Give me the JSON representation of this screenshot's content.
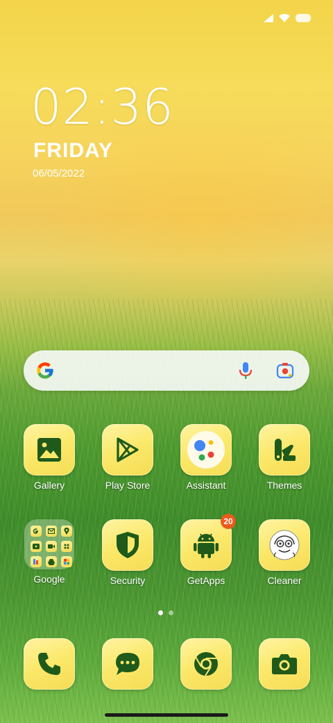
{
  "clock": {
    "time": "02:36",
    "day": "FRIDAY",
    "date": "06/05/2022"
  },
  "search": {
    "provider_icon": "google-g-icon",
    "voice_icon": "mic-icon",
    "lens_icon": "lens-camera-icon"
  },
  "apps_row1": [
    {
      "label": "Gallery",
      "icon": "gallery-icon"
    },
    {
      "label": "Play Store",
      "icon": "play-store-icon"
    },
    {
      "label": "Assistant",
      "icon": "assistant-icon"
    },
    {
      "label": "Themes",
      "icon": "themes-icon"
    }
  ],
  "apps_row2": [
    {
      "label": "Google",
      "icon": "folder-icon"
    },
    {
      "label": "Security",
      "icon": "shield-icon"
    },
    {
      "label": "GetApps",
      "icon": "android-icon",
      "badge": "20"
    },
    {
      "label": "Cleaner",
      "icon": "cleaner-icon"
    }
  ],
  "dock": [
    {
      "icon": "phone-icon"
    },
    {
      "icon": "messages-icon"
    },
    {
      "icon": "chrome-icon"
    },
    {
      "icon": "camera-icon"
    }
  ],
  "pages": {
    "count": 2,
    "active": 0
  },
  "colors": {
    "icon_dark": "#1f5a1a",
    "tile": "#fbe86a",
    "badge": "#ea5a1b"
  }
}
